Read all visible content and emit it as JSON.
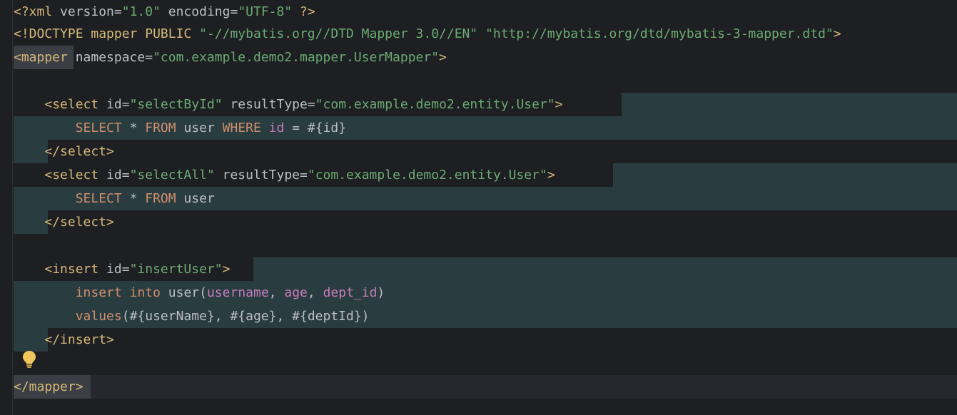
{
  "editor": {
    "file_type": "MyBatis mapper XML",
    "colors": {
      "background": "#1e1f22",
      "tag": "#d5b778",
      "attribute": "#bcbec4",
      "attribute_value": "#6aab73",
      "sql_keyword": "#cf8e6d",
      "sql_column": "#c77dbb",
      "injected_sql_background": "#293c40",
      "current_line": "#26282e"
    },
    "intention_icon": "lightbulb-icon",
    "lines": {
      "l1": {
        "a": "<?xml ",
        "b": "version",
        "c": "=",
        "d": "\"1.0\"",
        "e": " encoding",
        "f": "=",
        "g": "\"UTF-8\"",
        "h": " ?>"
      },
      "l2": {
        "a": "<!DOCTYPE mapper PUBLIC ",
        "b": "\"-//mybatis.org//DTD Mapper 3.0//EN\"",
        "c": " ",
        "d": "\"http://mybatis.org/dtd/mybatis-3-mapper.dtd\"",
        "e": ">"
      },
      "l3": {
        "a": "<mapper",
        "b": " namespace",
        "c": "=",
        "d": "\"com.example.demo2.mapper.UserMapper\"",
        "e": ">"
      },
      "l5": {
        "indent": "    ",
        "a": "<select",
        "b": " id",
        "c": "=",
        "d": "\"selectById\"",
        "e": " resultType",
        "f": "=",
        "g": "\"com.example.demo2.entity.User\"",
        "h": ">"
      },
      "l6": {
        "indent": "        ",
        "a": "SELECT",
        "b": " * ",
        "c": "FROM",
        "d": " user ",
        "e": "WHERE",
        "f": " ",
        "g": "id",
        "h": " = #{id}"
      },
      "l7": {
        "indent": "    ",
        "a": "</select>"
      },
      "l8": {
        "indent": "    ",
        "a": "<select",
        "b": " id",
        "c": "=",
        "d": "\"selectAll\"",
        "e": " resultType",
        "f": "=",
        "g": "\"com.example.demo2.entity.User\"",
        "h": ">"
      },
      "l9": {
        "indent": "        ",
        "a": "SELECT",
        "b": " * ",
        "c": "FROM",
        "d": " user"
      },
      "l10": {
        "indent": "    ",
        "a": "</select>"
      },
      "l12": {
        "indent": "    ",
        "a": "<insert",
        "b": " id",
        "c": "=",
        "d": "\"insertUser\"",
        "e": ">"
      },
      "l13": {
        "indent": "        ",
        "a": "insert",
        "b": " ",
        "c": "into",
        "d": " user(",
        "e": "username",
        "f": ", ",
        "g": "age",
        "h": ", ",
        "i": "dept_id",
        "j": ")"
      },
      "l14": {
        "indent": "        ",
        "a": "values",
        "b": "(#{userName}, #{age}, #{deptId})"
      },
      "l15": {
        "indent": "    ",
        "a": "</insert>"
      },
      "l17": {
        "a": "</mapper>"
      }
    }
  }
}
